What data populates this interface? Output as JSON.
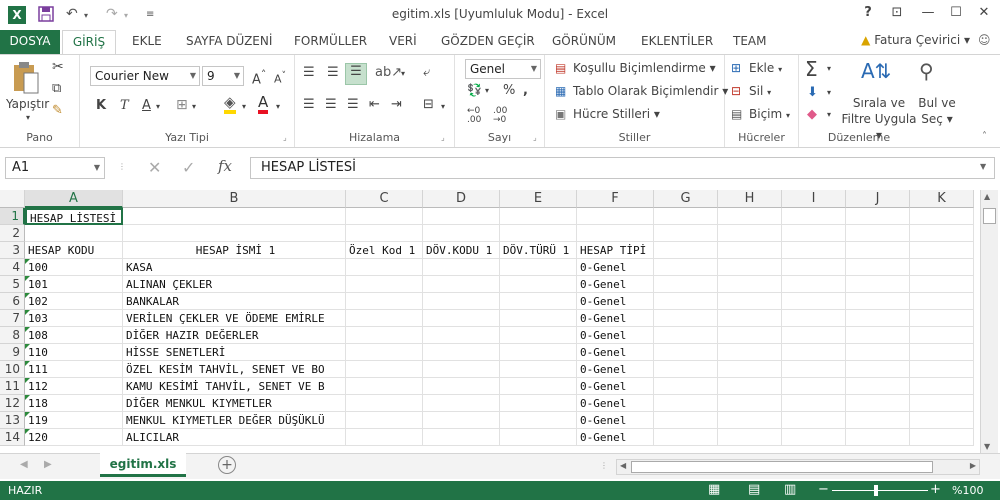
{
  "window": {
    "title": "egitim.xls  [Uyumluluk Modu] - Excel",
    "help": "?"
  },
  "tabs": [
    "DOSYA",
    "GİRİŞ",
    "EKLE",
    "SAYFA DÜZENİ",
    "FORMÜLLER",
    "VERİ",
    "GÖZDEN GEÇİR",
    "GÖRÜNÜM",
    "EKLENTİLER",
    "TEAM"
  ],
  "user": "Fatura Çevirici",
  "ribbon": {
    "pano": {
      "label": "Pano",
      "paste": "Yapıştır"
    },
    "font": {
      "label": "Yazı Tipi",
      "name": "Courier New",
      "size": "9",
      "bold": "K",
      "italic": "T",
      "underline": "A"
    },
    "align": {
      "label": "Hizalama"
    },
    "number": {
      "label": "Sayı",
      "format": "Genel",
      "percent": "%"
    },
    "styles": {
      "label": "Stiller",
      "cond": "Koşullu Biçimlendirme",
      "table": "Tablo Olarak Biçimlendir",
      "cell": "Hücre Stilleri"
    },
    "cells": {
      "label": "Hücreler",
      "insert": "Ekle",
      "delete": "Sil",
      "format": "Biçim"
    },
    "editing": {
      "label": "Düzenleme",
      "sort": "Sırala ve Filtre Uygula",
      "find": "Bul ve Seç"
    }
  },
  "formula_bar": {
    "name_box": "A1",
    "fx": "fx",
    "content": "HESAP LİSTESİ"
  },
  "columns": [
    "A",
    "B",
    "C",
    "D",
    "E",
    "F",
    "G",
    "H",
    "I",
    "J",
    "K"
  ],
  "rows": [
    {
      "n": "1",
      "a": "HESAP LİSTESİ",
      "b": "",
      "c": "",
      "d": "",
      "e": "",
      "f": ""
    },
    {
      "n": "2",
      "a": "",
      "b": "",
      "c": "",
      "d": "",
      "e": "",
      "f": ""
    },
    {
      "n": "3",
      "a": "HESAP KODU",
      "b": "HESAP İSMİ 1",
      "c": "Özel Kod 1",
      "d": "DÖV.KODU 1",
      "e": "DÖV.TÜRÜ 1",
      "f": "HESAP TİPİ"
    },
    {
      "n": "4",
      "a": "100",
      "b": "KASA",
      "c": "",
      "d": "",
      "e": "",
      "f": "0-Genel"
    },
    {
      "n": "5",
      "a": "101",
      "b": "ALINAN ÇEKLER",
      "c": "",
      "d": "",
      "e": "",
      "f": "0-Genel"
    },
    {
      "n": "6",
      "a": "102",
      "b": "BANKALAR",
      "c": "",
      "d": "",
      "e": "",
      "f": "0-Genel"
    },
    {
      "n": "7",
      "a": "103",
      "b": "VERİLEN ÇEKLER VE ÖDEME EMİRLE",
      "c": "",
      "d": "",
      "e": "",
      "f": "0-Genel"
    },
    {
      "n": "8",
      "a": "108",
      "b": "DİĞER HAZIR DEĞERLER",
      "c": "",
      "d": "",
      "e": "",
      "f": "0-Genel"
    },
    {
      "n": "9",
      "a": "110",
      "b": "HİSSE SENETLERİ",
      "c": "",
      "d": "",
      "e": "",
      "f": "0-Genel"
    },
    {
      "n": "10",
      "a": "111",
      "b": "ÖZEL KESİM TAHVİL, SENET VE BO",
      "c": "",
      "d": "",
      "e": "",
      "f": "0-Genel"
    },
    {
      "n": "11",
      "a": "112",
      "b": "KAMU KESİMİ TAHVİL, SENET VE B",
      "c": "",
      "d": "",
      "e": "",
      "f": "0-Genel"
    },
    {
      "n": "12",
      "a": "118",
      "b": "DİĞER MENKUL KIYMETLER",
      "c": "",
      "d": "",
      "e": "",
      "f": "0-Genel"
    },
    {
      "n": "13",
      "a": "119",
      "b": "MENKUL KIYMETLER DEĞER DÜŞÜKLÜ",
      "c": "",
      "d": "",
      "e": "",
      "f": "0-Genel"
    },
    {
      "n": "14",
      "a": "120",
      "b": "ALICILAR",
      "c": "",
      "d": "",
      "e": "",
      "f": "0-Genel"
    }
  ],
  "sheet": {
    "tab": "egitim.xls"
  },
  "status": {
    "ready": "HAZIR",
    "zoom": "%100"
  },
  "colors": {
    "accent": "#217346"
  }
}
